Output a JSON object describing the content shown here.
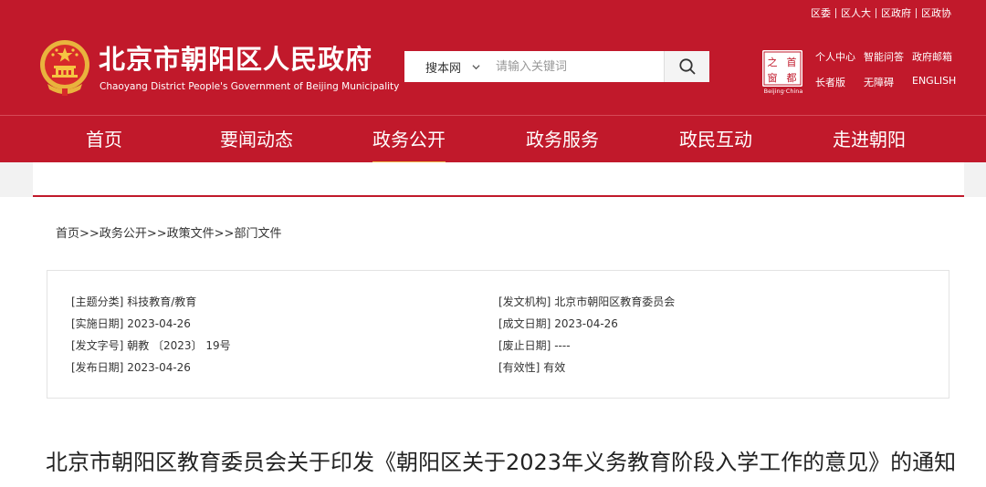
{
  "top_links": [
    "区委",
    "区人大",
    "区政府",
    "区政协"
  ],
  "site": {
    "title": "北京市朝阳区人民政府",
    "subtitle": "Chaoyang District People's Government of Beijing Municipality"
  },
  "search": {
    "scope": "搜本网",
    "placeholder": "请输入关键词"
  },
  "capital_logo": {
    "chars": [
      "之",
      "首",
      "窗",
      "都"
    ],
    "caption": "Beijing·China"
  },
  "quick_links": {
    "row1": [
      "个人中心",
      "智能问答",
      "政府邮箱"
    ],
    "row2": [
      "长者版",
      "无障碍",
      "ENGLISH"
    ]
  },
  "nav": {
    "items": [
      "首页",
      "要闻动态",
      "政务公开",
      "政务服务",
      "政民互动",
      "走进朝阳"
    ],
    "active": "政务公开"
  },
  "breadcrumb": [
    "首页",
    "政务公开",
    "政策文件",
    "部门文件"
  ],
  "breadcrumb_sep": ">>",
  "meta": {
    "left": [
      {
        "label": "[主题分类]",
        "value": "科技教育/教育"
      },
      {
        "label": "[实施日期]",
        "value": "2023-04-26"
      },
      {
        "label": "[发文字号]",
        "value": "朝教 〔2023〕 19号"
      },
      {
        "label": "[发布日期]",
        "value": "2023-04-26"
      }
    ],
    "right": [
      {
        "label": "[发文机构]",
        "value": "北京市朝阳区教育委员会"
      },
      {
        "label": "[成文日期]",
        "value": "2023-04-26"
      },
      {
        "label": "[废止日期]",
        "value": "----"
      },
      {
        "label": "[有效性]",
        "value": "有效"
      }
    ]
  },
  "document": {
    "title": "北京市朝阳区教育委员会关于印发《朝阳区关于2023年义务教育阶段入学工作的意见》的通知"
  },
  "colors": {
    "brand_red": "#c1192b",
    "nav_active_underline": "#f0b64b"
  }
}
